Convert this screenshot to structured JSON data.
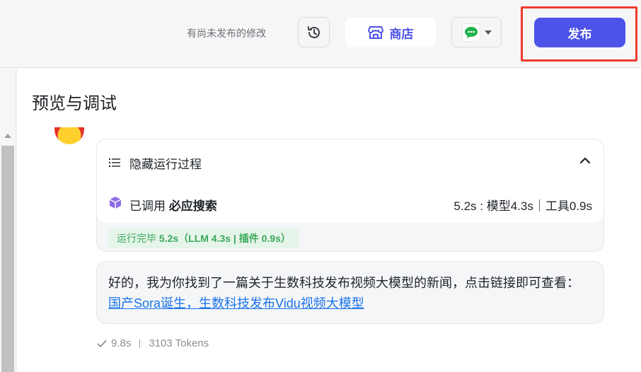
{
  "header": {
    "unpublished_text": "有尚未发布的修改",
    "store_label": "商店",
    "publish_label": "发布",
    "accent_color": "#4d53e8",
    "highlight_color": "#f03a2e"
  },
  "icons": {
    "history": "history-icon",
    "store": "store-icon",
    "wechat": "wechat-icon",
    "dropdown": "chevron-down-icon",
    "list": "list-icon",
    "collapse": "chevron-up-icon",
    "plugin": "cube-icon",
    "check": "check-icon"
  },
  "panel": {
    "title": "预览与调试"
  },
  "process": {
    "hide_label": "隐藏运行过程",
    "called_prefix": "已调用 ",
    "tool_name": "必应搜索",
    "timing": "5.2s : 模型4.3s｜工具0.9s",
    "done_prefix": "运行完毕 ",
    "done_detail": "5.2s（LLM 4.3s | 插件 0.9s）"
  },
  "answer": {
    "text": "好的，我为你找到了一篇关于生数科技发布视频大模型的新闻，点击链接即可查看：",
    "link_text": "国产Sora诞生，生数科技发布Vidu视频大模型"
  },
  "meta": {
    "duration": "9.8s",
    "tokens": "3103 Tokens"
  }
}
